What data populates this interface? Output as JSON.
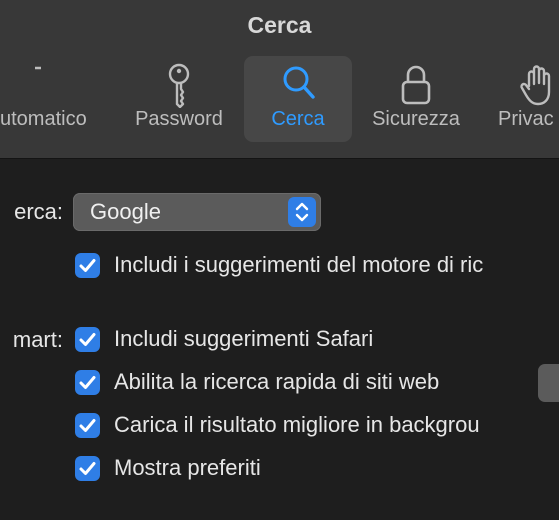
{
  "window": {
    "title": "Cerca"
  },
  "tabs": [
    {
      "label": "utomatico",
      "icon": "general-icon",
      "selected": false
    },
    {
      "label": "Password",
      "icon": "key-icon",
      "selected": false
    },
    {
      "label": "Cerca",
      "icon": "search-icon",
      "selected": true
    },
    {
      "label": "Sicurezza",
      "icon": "lock-icon",
      "selected": false
    },
    {
      "label": "Privac",
      "icon": "hand-icon",
      "selected": false
    }
  ],
  "search_engine": {
    "label": "erca:",
    "selected": "Google",
    "include_suggestions": "Includi i suggerimenti del motore di ric"
  },
  "smart_search": {
    "label": "mart:",
    "options": [
      {
        "label": "Includi suggerimenti Safari",
        "checked": true
      },
      {
        "label": "Abilita la ricerca rapida di siti web",
        "checked": true
      },
      {
        "label": "Carica il risultato migliore in backgrou",
        "checked": true
      },
      {
        "label": "Mostra preferiti",
        "checked": true
      }
    ]
  },
  "colors": {
    "accent": "#2f7ee6",
    "selected_tab_text": "#2f9bff",
    "toolbar_bg": "#383838",
    "content_bg": "#1e1e1e"
  }
}
